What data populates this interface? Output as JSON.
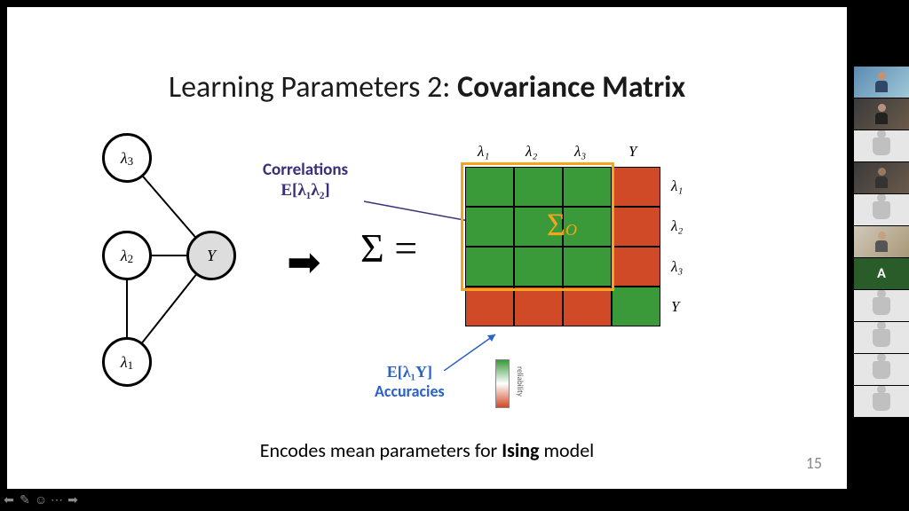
{
  "slide": {
    "title_prefix": "Learning Parameters 2: ",
    "title_bold": "Covariance Matrix",
    "correlations_label": "Correlations",
    "correlations_expr": "E[λ₁λ₂]",
    "accuracies_label": "Accuracies",
    "accuracies_expr": "E[λ₁Y]",
    "sigma_eq": "Σ =",
    "sigma_o": "Σ",
    "sigma_o_sub": "O",
    "arrow": "➡",
    "col_labels": [
      "λ₁",
      "λ₂",
      "λ₃",
      "Y"
    ],
    "row_labels": [
      "λ₁",
      "λ₂",
      "λ₃",
      "Y"
    ],
    "legend_label": "reliability",
    "caption_prefix": "Encodes mean parameters for ",
    "caption_bold": "Ising",
    "caption_suffix": " model",
    "page_number": "15",
    "nodes": {
      "l1": "λ₁",
      "l2": "λ₂",
      "l3": "λ₃",
      "Y": "Y"
    }
  },
  "controls": {
    "prev": "⬅",
    "pen": "✎",
    "smile": "☺",
    "more": "⋯",
    "next": "➡"
  },
  "participants": {
    "letter_tile": "A"
  }
}
